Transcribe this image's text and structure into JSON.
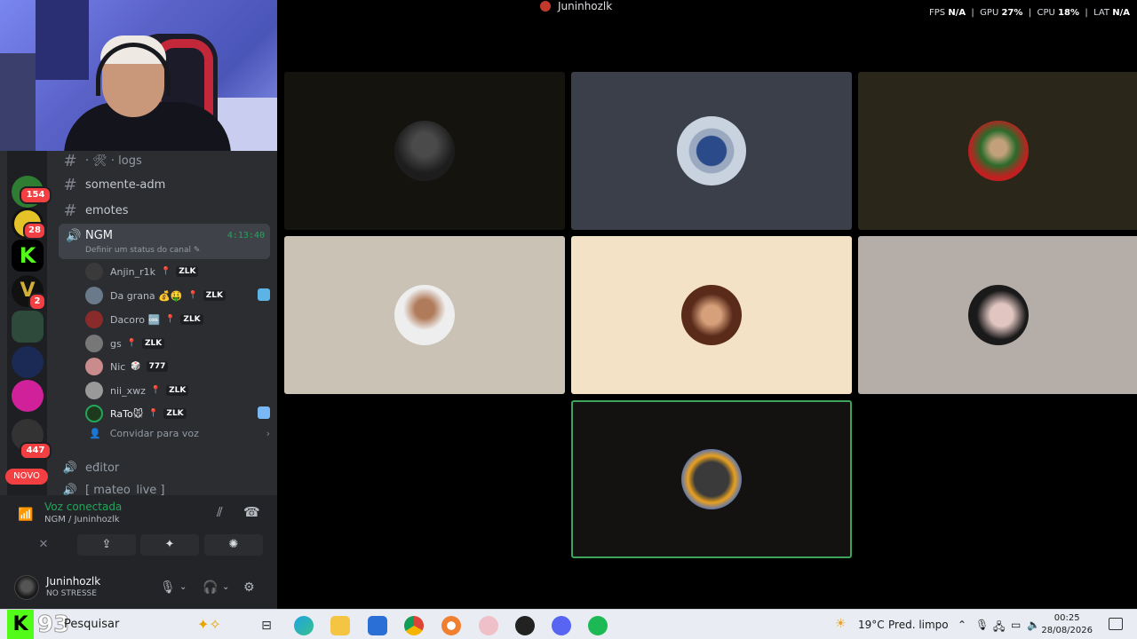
{
  "window_title": "Juninhozlk",
  "perf": {
    "fps_label": "FPS",
    "fps": "N/A",
    "gpu_label": "GPU",
    "gpu": "27%",
    "cpu_label": "CPU",
    "cpu": "18%",
    "lat_label": "LAT",
    "lat": "N/A"
  },
  "guilds": {
    "badges": [
      "154",
      "28",
      "2",
      "447"
    ],
    "novo": "NOVO"
  },
  "channels": {
    "logs": "· 🛠 · logs",
    "somente_adm": "somente-adm",
    "emotes": "emotes",
    "voice_channel": "NGM",
    "voice_time": "4:13:40",
    "voice_status": "Definir um status do canal ✎",
    "editor": "eđitor",
    "next_partial": "[ mateo_live ]"
  },
  "members": [
    {
      "name": "Anjin_r1k",
      "tag": "ZLK"
    },
    {
      "name": "Da grana 💰🤑",
      "tag": "ZLK"
    },
    {
      "name": "Dacoro 🆒",
      "tag": "ZLK"
    },
    {
      "name": "gs",
      "tag": "ZLK"
    },
    {
      "name": "Nic",
      "tag": "777"
    },
    {
      "name": "nii_xwz",
      "tag": "ZLK"
    },
    {
      "name": "RaTo🐭",
      "tag": "ZLK"
    }
  ],
  "invite": "Convidar para voz",
  "voice_panel": {
    "title": "Voz conectada",
    "subtitle": "NGM / Juninhozlk"
  },
  "user_panel": {
    "name": "Juninhozlk",
    "status": "NO STRESSE"
  },
  "taskbar": {
    "logo": "K",
    "number": "93",
    "search": "Pesquisar",
    "weather_temp": "19°C",
    "weather_desc": "Pred. limpo",
    "time": "00:25",
    "date": "28/08/2026"
  }
}
